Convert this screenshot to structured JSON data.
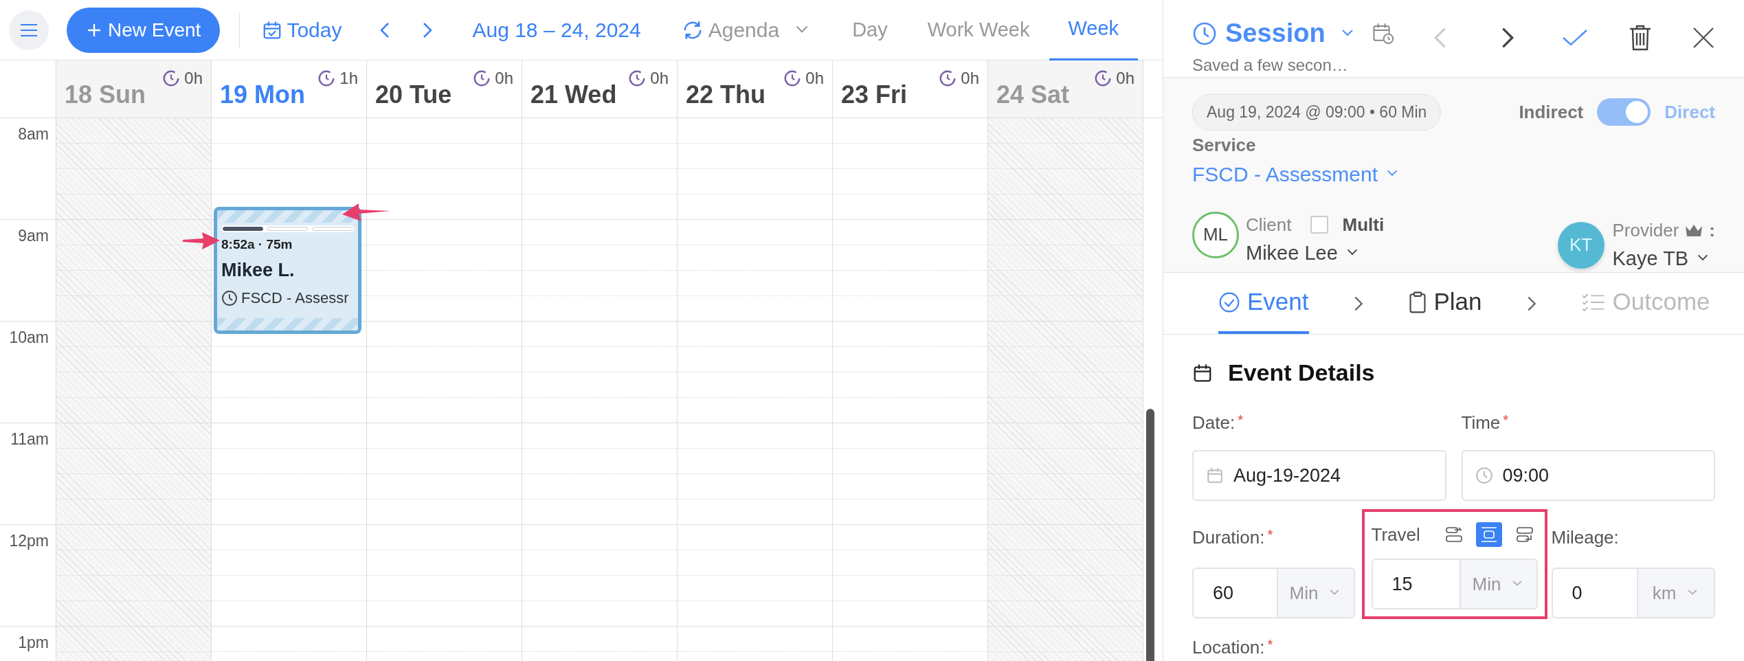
{
  "toolbar": {
    "new_event": "New Event",
    "today": "Today",
    "range": "Aug 18 – 24, 2024",
    "view_mode": "Agenda",
    "views": [
      {
        "label": "Day",
        "selected": false
      },
      {
        "label": "Work Week",
        "selected": false
      },
      {
        "label": "Week",
        "selected": true
      }
    ]
  },
  "calendar": {
    "hours": [
      "8am",
      "9am",
      "10am",
      "11am",
      "12pm",
      "1pm"
    ],
    "days": [
      {
        "label": "18 Sun",
        "total": "0h",
        "today": false,
        "off": true
      },
      {
        "label": "19 Mon",
        "total": "1h",
        "today": true,
        "off": false,
        "events": [
          {
            "time": "8:52a · 75m",
            "title": "Mikee L.",
            "service": "FSCD - Assessr",
            "steps": [
              {
                "done": true
              },
              {
                "done": false
              },
              {
                "done": false
              }
            ]
          }
        ]
      },
      {
        "label": "20 Tue",
        "total": "0h",
        "today": false,
        "off": false
      },
      {
        "label": "21 Wed",
        "total": "0h",
        "today": false,
        "off": false
      },
      {
        "label": "22 Thu",
        "total": "0h",
        "today": false,
        "off": false
      },
      {
        "label": "23 Fri",
        "total": "0h",
        "today": false,
        "off": false
      },
      {
        "label": "24 Sat",
        "total": "0h",
        "today": false,
        "off": true
      }
    ]
  },
  "panel": {
    "type": "Session",
    "saved": "Saved a few secon…",
    "prev_disabled": true,
    "summary": "Aug 19, 2024 @ 09:00 • 60 Min",
    "toggle": {
      "off_label": "Indirect",
      "on_label": "Direct",
      "on": true
    },
    "service": {
      "label": "Service",
      "value": "FSCD - Assessment"
    },
    "client": {
      "initials": "ML",
      "label": "Client",
      "multi_label": "Multi",
      "multi_checked": false,
      "name": "Mikee Lee"
    },
    "provider": {
      "initials": "KT",
      "label": "Provider",
      "suffix": ":",
      "name": "Kaye TB"
    },
    "tabs": [
      {
        "label": "Event",
        "kind": "event",
        "selected": true,
        "disabled": false
      },
      {
        "label": "Plan",
        "kind": "plan",
        "selected": false,
        "disabled": false
      },
      {
        "label": "Outcome",
        "kind": "outcome",
        "selected": false,
        "disabled": true
      }
    ],
    "details": {
      "title": "Event Details",
      "date": {
        "label": "Date:",
        "mark": "*",
        "value": "Aug-19-2024"
      },
      "time": {
        "label": "Time",
        "mark": "*",
        "value": "09:00"
      },
      "duration": {
        "label": "Duration:",
        "mark": "*",
        "value": "60",
        "unit": "Min"
      },
      "travel": {
        "label": "Travel",
        "highlighted": true,
        "value": "15",
        "unit": "Min",
        "modes": [
          {
            "kind": "before",
            "selected": false
          },
          {
            "kind": "both",
            "selected": true
          },
          {
            "kind": "after",
            "selected": false
          }
        ]
      },
      "mileage": {
        "label": "Mileage:",
        "value": "0",
        "unit": "km"
      },
      "location": {
        "label": "Location:",
        "mark": "*"
      }
    }
  }
}
